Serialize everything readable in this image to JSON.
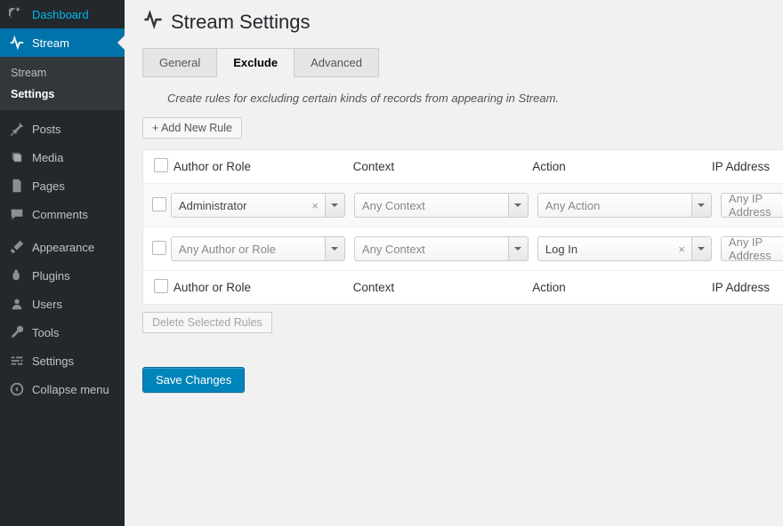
{
  "sidebar": {
    "items": [
      {
        "label": "Dashboard",
        "icon": "gauge"
      },
      {
        "label": "Stream",
        "icon": "pulse",
        "active": true
      },
      {
        "label": "Posts",
        "icon": "pin"
      },
      {
        "label": "Media",
        "icon": "media"
      },
      {
        "label": "Pages",
        "icon": "page"
      },
      {
        "label": "Comments",
        "icon": "comment"
      },
      {
        "label": "Appearance",
        "icon": "brush"
      },
      {
        "label": "Plugins",
        "icon": "plug"
      },
      {
        "label": "Users",
        "icon": "user"
      },
      {
        "label": "Tools",
        "icon": "wrench"
      },
      {
        "label": "Settings",
        "icon": "sliders"
      },
      {
        "label": "Collapse menu",
        "icon": "collapse"
      }
    ],
    "sub": {
      "items": [
        {
          "label": "Stream",
          "current": false
        },
        {
          "label": "Settings",
          "current": true
        }
      ]
    }
  },
  "page": {
    "title": "Stream Settings"
  },
  "tabs": {
    "items": [
      {
        "label": "General",
        "active": false
      },
      {
        "label": "Exclude",
        "active": true
      },
      {
        "label": "Advanced",
        "active": false
      }
    ]
  },
  "help_text": "Create rules for excluding certain kinds of records from appearing in Stream.",
  "buttons": {
    "add_rule": "+ Add New Rule",
    "delete_selected": "Delete Selected Rules",
    "save": "Save Changes"
  },
  "columns": {
    "author": "Author or Role",
    "context": "Context",
    "action": "Action",
    "ip": "IP Address"
  },
  "placeholders": {
    "any_author": "Any Author or Role",
    "any_context": "Any Context",
    "any_action": "Any Action",
    "any_ip": "Any IP Address"
  },
  "rules": [
    {
      "author": "Administrator",
      "author_clear": true,
      "context": "",
      "action": "",
      "ip": ""
    },
    {
      "author": "",
      "author_clear": false,
      "context": "",
      "action": "Log In",
      "action_clear": true,
      "ip": ""
    }
  ]
}
